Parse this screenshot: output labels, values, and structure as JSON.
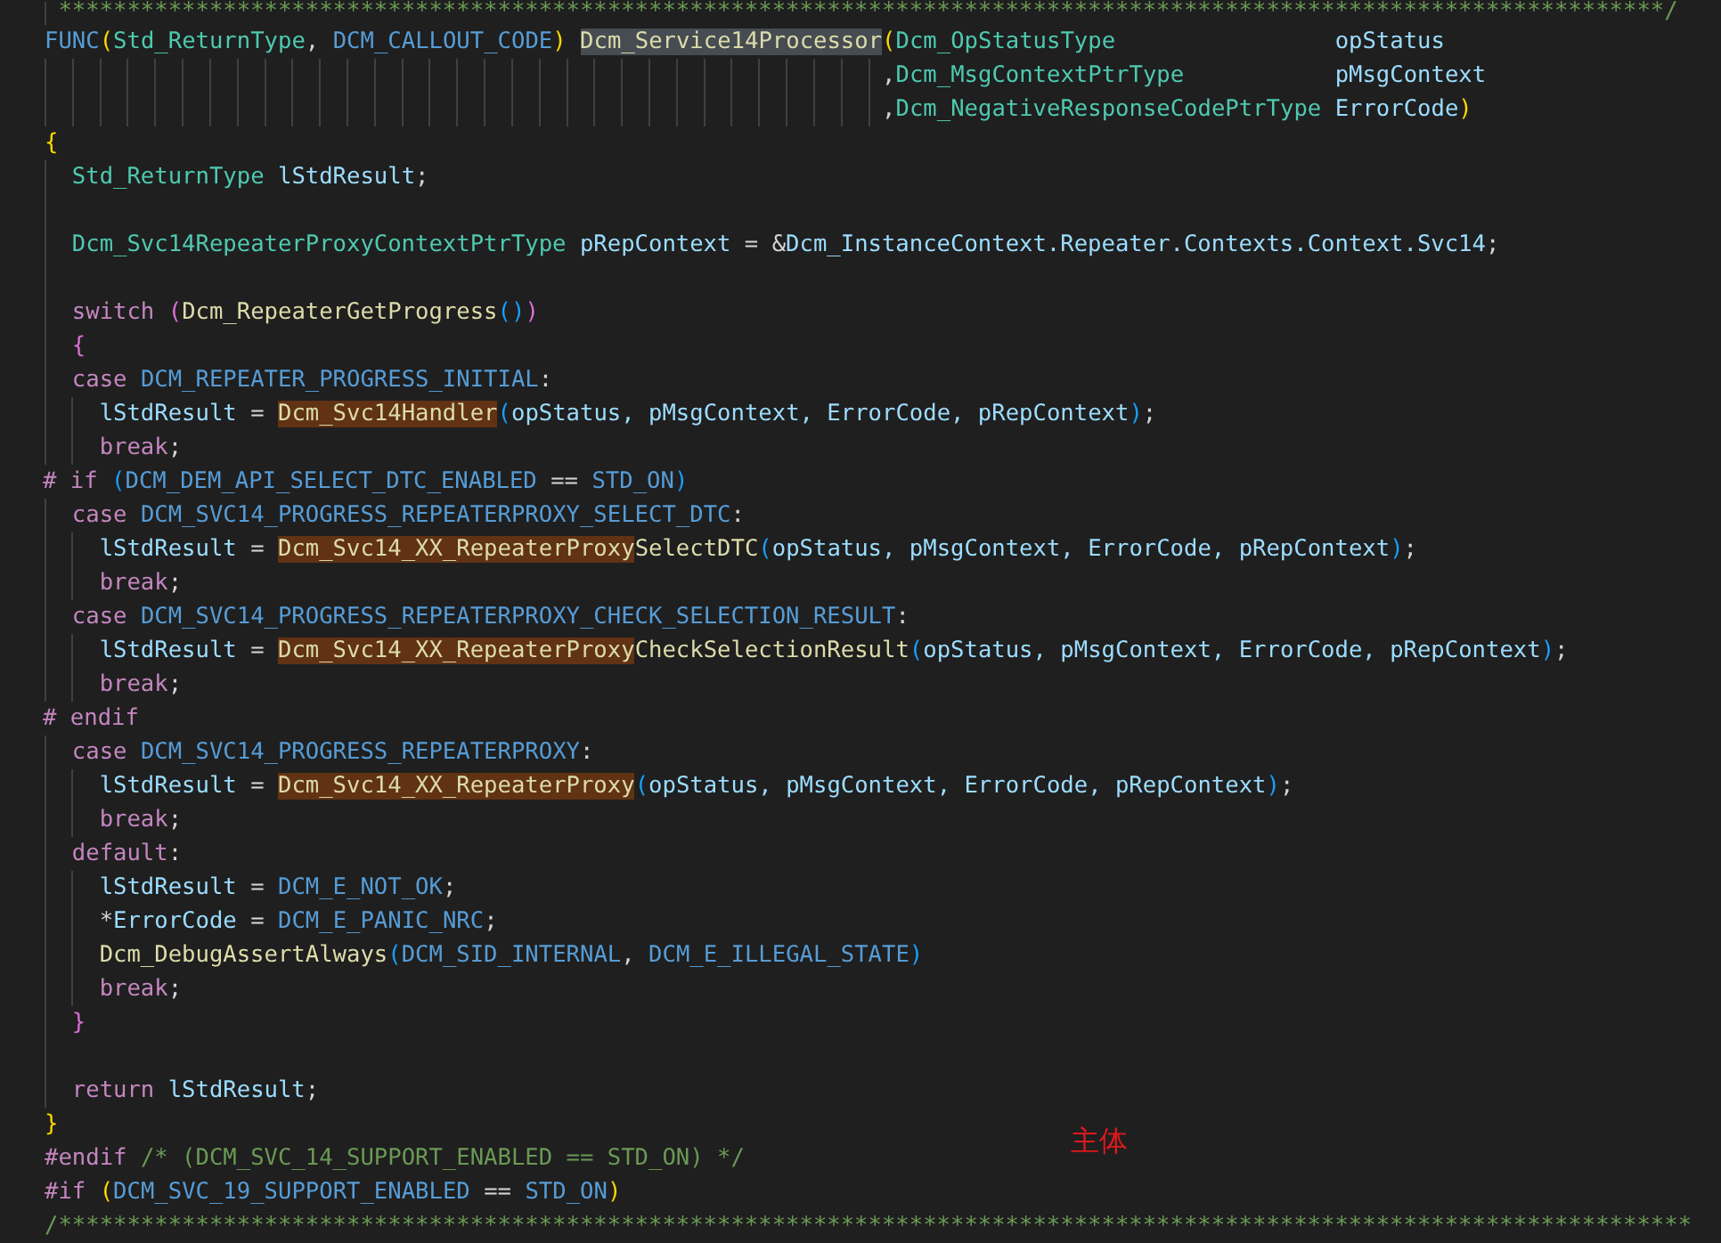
{
  "code_lines": [
    {
      "kind": "rule",
      "tokens": [
        {
          "text": "*********************************************************************************************************************/",
          "kind": "comment"
        }
      ]
    },
    {
      "kind": "signature",
      "head": [
        {
          "text": "FUNC",
          "kind": "keyword"
        },
        {
          "text": "(",
          "kind": "bracket1"
        },
        {
          "text": "Std_ReturnType",
          "kind": "type"
        },
        {
          "text": ", ",
          "kind": "plain"
        },
        {
          "text": "DCM_CALLOUT_CODE",
          "kind": "keyword"
        },
        {
          "text": ") ",
          "kind": "bracket1"
        },
        {
          "text": "Dcm_Service14Processor",
          "kind": "function_selected"
        }
      ],
      "params": [
        {
          "lead": {
            "text": "(",
            "kind": "bracket1"
          },
          "type": "Dcm_OpStatusType",
          "name": "opStatus"
        },
        {
          "lead": {
            "text": ",",
            "kind": "plain"
          },
          "type": "Dcm_MsgContextPtrType",
          "name": "pMsgContext"
        },
        {
          "lead": {
            "text": ",",
            "kind": "plain"
          },
          "type": "Dcm_NegativeResponseCodePtrType",
          "name": "ErrorCode",
          "close": {
            "text": ")",
            "kind": "bracket1"
          }
        }
      ]
    },
    {
      "kind": "code",
      "tokens": [
        {
          "text": "{",
          "kind": "bracket1"
        }
      ],
      "children": [
        {
          "kind": "code",
          "tokens": [
            {
              "text": "Std_ReturnType ",
              "kind": "type"
            },
            {
              "text": "lStdResult",
              "kind": "variable"
            },
            {
              "text": ";",
              "kind": "plain"
            }
          ]
        },
        {
          "kind": "blank"
        },
        {
          "kind": "code",
          "tokens": [
            {
              "text": "Dcm_Svc14RepeaterProxyContextPtrType ",
              "kind": "type"
            },
            {
              "text": "pRepContext",
              "kind": "variable"
            },
            {
              "text": " = &",
              "kind": "plain"
            },
            {
              "text": "Dcm_InstanceContext.Repeater.Contexts.Context.Svc14",
              "kind": "variable"
            },
            {
              "text": ";",
              "kind": "plain"
            }
          ]
        },
        {
          "kind": "blank"
        },
        {
          "kind": "code",
          "tokens": [
            {
              "text": "switch ",
              "kind": "control"
            },
            {
              "text": "(",
              "kind": "bracket2"
            },
            {
              "text": "Dcm_RepeaterGetProgress",
              "kind": "function"
            },
            {
              "text": "()",
              "kind": "bracket3"
            },
            {
              "text": ")",
              "kind": "bracket2"
            }
          ]
        },
        {
          "kind": "code",
          "tokens": [
            {
              "text": "{",
              "kind": "bracket2"
            }
          ]
        },
        {
          "kind": "code",
          "tokens": [
            {
              "text": "case ",
              "kind": "control"
            },
            {
              "text": "DCM_REPEATER_PROGRESS_INITIAL",
              "kind": "keyword"
            },
            {
              "text": ":",
              "kind": "plain"
            }
          ],
          "children": [
            {
              "kind": "code",
              "tokens": [
                {
                  "text": "lStdResult",
                  "kind": "variable"
                },
                {
                  "text": " = ",
                  "kind": "plain"
                },
                {
                  "text": "Dcm_Svc14Handler",
                  "kind": "function_match"
                },
                {
                  "text": "(",
                  "kind": "bracket3"
                },
                {
                  "text": "opStatus, pMsgContext, ErrorCode, pRepContext",
                  "kind": "variable"
                },
                {
                  "text": ")",
                  "kind": "bracket3"
                },
                {
                  "text": ";",
                  "kind": "plain"
                }
              ]
            },
            {
              "kind": "code",
              "tokens": [
                {
                  "text": "break",
                  "kind": "control"
                },
                {
                  "text": ";",
                  "kind": "plain"
                }
              ]
            }
          ]
        },
        {
          "kind": "preprocessor",
          "tokens": [
            {
              "text": "# if ",
              "kind": "control"
            },
            {
              "text": "(",
              "kind": "bracket3"
            },
            {
              "text": "DCM_DEM_API_SELECT_DTC_ENABLED",
              "kind": "keyword"
            },
            {
              "text": " == ",
              "kind": "plain"
            },
            {
              "text": "STD_ON",
              "kind": "keyword"
            },
            {
              "text": ")",
              "kind": "bracket3"
            }
          ]
        },
        {
          "kind": "code",
          "tokens": [
            {
              "text": "case ",
              "kind": "control"
            },
            {
              "text": "DCM_SVC14_PROGRESS_REPEATERPROXY_SELECT_DTC",
              "kind": "keyword"
            },
            {
              "text": ":",
              "kind": "plain"
            }
          ],
          "children": [
            {
              "kind": "code",
              "tokens": [
                {
                  "text": "lStdResult",
                  "kind": "variable"
                },
                {
                  "text": " = ",
                  "kind": "plain"
                },
                {
                  "text": "Dcm_Svc14_XX_RepeaterProxy",
                  "kind": "function_match"
                },
                {
                  "text": "SelectDTC",
                  "kind": "function"
                },
                {
                  "text": "(",
                  "kind": "bracket3"
                },
                {
                  "text": "opStatus, pMsgContext, ErrorCode, pRepContext",
                  "kind": "variable"
                },
                {
                  "text": ")",
                  "kind": "bracket3"
                },
                {
                  "text": ";",
                  "kind": "plain"
                }
              ]
            },
            {
              "kind": "code",
              "tokens": [
                {
                  "text": "break",
                  "kind": "control"
                },
                {
                  "text": ";",
                  "kind": "plain"
                }
              ]
            }
          ]
        },
        {
          "kind": "code",
          "tokens": [
            {
              "text": "case ",
              "kind": "control"
            },
            {
              "text": "DCM_SVC14_PROGRESS_REPEATERPROXY_CHECK_SELECTION_RESULT",
              "kind": "keyword"
            },
            {
              "text": ":",
              "kind": "plain"
            }
          ],
          "children": [
            {
              "kind": "code",
              "tokens": [
                {
                  "text": "lStdResult",
                  "kind": "variable"
                },
                {
                  "text": " = ",
                  "kind": "plain"
                },
                {
                  "text": "Dcm_Svc14_XX_RepeaterProxy",
                  "kind": "function_match"
                },
                {
                  "text": "CheckSelectionResult",
                  "kind": "function"
                },
                {
                  "text": "(",
                  "kind": "bracket3"
                },
                {
                  "text": "opStatus, pMsgContext, ErrorCode, pRepContext",
                  "kind": "variable"
                },
                {
                  "text": ")",
                  "kind": "bracket3"
                },
                {
                  "text": ";",
                  "kind": "plain"
                }
              ]
            },
            {
              "kind": "code",
              "tokens": [
                {
                  "text": "break",
                  "kind": "control"
                },
                {
                  "text": ";",
                  "kind": "plain"
                }
              ]
            }
          ]
        },
        {
          "kind": "preprocessor",
          "tokens": [
            {
              "text": "# endif",
              "kind": "control"
            }
          ]
        },
        {
          "kind": "code",
          "tokens": [
            {
              "text": "case ",
              "kind": "control"
            },
            {
              "text": "DCM_SVC14_PROGRESS_REPEATERPROXY",
              "kind": "keyword"
            },
            {
              "text": ":",
              "kind": "plain"
            }
          ],
          "children": [
            {
              "kind": "code",
              "tokens": [
                {
                  "text": "lStdResult",
                  "kind": "variable"
                },
                {
                  "text": " = ",
                  "kind": "plain"
                },
                {
                  "text": "Dcm_Svc14_XX_RepeaterProxy",
                  "kind": "function_match"
                },
                {
                  "text": "(",
                  "kind": "bracket3"
                },
                {
                  "text": "opStatus, pMsgContext, ErrorCode, pRepContext",
                  "kind": "variable"
                },
                {
                  "text": ")",
                  "kind": "bracket3"
                },
                {
                  "text": ";",
                  "kind": "plain"
                }
              ]
            },
            {
              "kind": "code",
              "tokens": [
                {
                  "text": "break",
                  "kind": "control"
                },
                {
                  "text": ";",
                  "kind": "plain"
                }
              ]
            }
          ]
        },
        {
          "kind": "code",
          "tokens": [
            {
              "text": "default",
              "kind": "control"
            },
            {
              "text": ":",
              "kind": "plain"
            }
          ],
          "children": [
            {
              "kind": "code",
              "tokens": [
                {
                  "text": "lStdResult",
                  "kind": "variable"
                },
                {
                  "text": " = ",
                  "kind": "plain"
                },
                {
                  "text": "DCM_E_NOT_OK",
                  "kind": "keyword"
                },
                {
                  "text": ";",
                  "kind": "plain"
                }
              ]
            },
            {
              "kind": "code",
              "tokens": [
                {
                  "text": "*",
                  "kind": "plain"
                },
                {
                  "text": "ErrorCode",
                  "kind": "variable"
                },
                {
                  "text": " = ",
                  "kind": "plain"
                },
                {
                  "text": "DCM_E_PANIC_NRC",
                  "kind": "keyword"
                },
                {
                  "text": ";",
                  "kind": "plain"
                }
              ]
            },
            {
              "kind": "code",
              "tokens": [
                {
                  "text": "Dcm_DebugAssertAlways",
                  "kind": "function"
                },
                {
                  "text": "(",
                  "kind": "bracket3"
                },
                {
                  "text": "DCM_SID_INTERNAL",
                  "kind": "keyword"
                },
                {
                  "text": ", ",
                  "kind": "plain"
                },
                {
                  "text": "DCM_E_ILLEGAL_STATE",
                  "kind": "keyword"
                },
                {
                  "text": ")",
                  "kind": "bracket3"
                }
              ]
            },
            {
              "kind": "code",
              "tokens": [
                {
                  "text": "break",
                  "kind": "control"
                },
                {
                  "text": ";",
                  "kind": "plain"
                }
              ]
            }
          ]
        },
        {
          "kind": "code",
          "tokens": [
            {
              "text": "}",
              "kind": "bracket2"
            }
          ]
        },
        {
          "kind": "blank"
        },
        {
          "kind": "code",
          "tokens": [
            {
              "text": "return ",
              "kind": "control"
            },
            {
              "text": "lStdResult",
              "kind": "variable"
            },
            {
              "text": ";",
              "kind": "plain"
            }
          ]
        }
      ]
    },
    {
      "kind": "code",
      "tokens": [
        {
          "text": "}",
          "kind": "bracket1"
        }
      ]
    },
    {
      "kind": "preprocessor",
      "tokens": [
        {
          "text": "#endif",
          "kind": "control"
        },
        {
          "text": " /* (DCM_SVC_14_SUPPORT_ENABLED == STD_ON) */",
          "kind": "comment"
        }
      ]
    },
    {
      "kind": "preprocessor",
      "tokens": [
        {
          "text": "#if ",
          "kind": "control"
        },
        {
          "text": "(",
          "kind": "bracket1"
        },
        {
          "text": "DCM_SVC_19_SUPPORT_ENABLED",
          "kind": "keyword"
        },
        {
          "text": " == ",
          "kind": "plain"
        },
        {
          "text": "STD_ON",
          "kind": "keyword"
        },
        {
          "text": ")",
          "kind": "bracket1"
        }
      ]
    },
    {
      "kind": "code",
      "tokens": [
        {
          "text": "/***********************************************************************************************************************",
          "kind": "comment"
        }
      ]
    }
  ],
  "annotation": {
    "text": "主体"
  }
}
